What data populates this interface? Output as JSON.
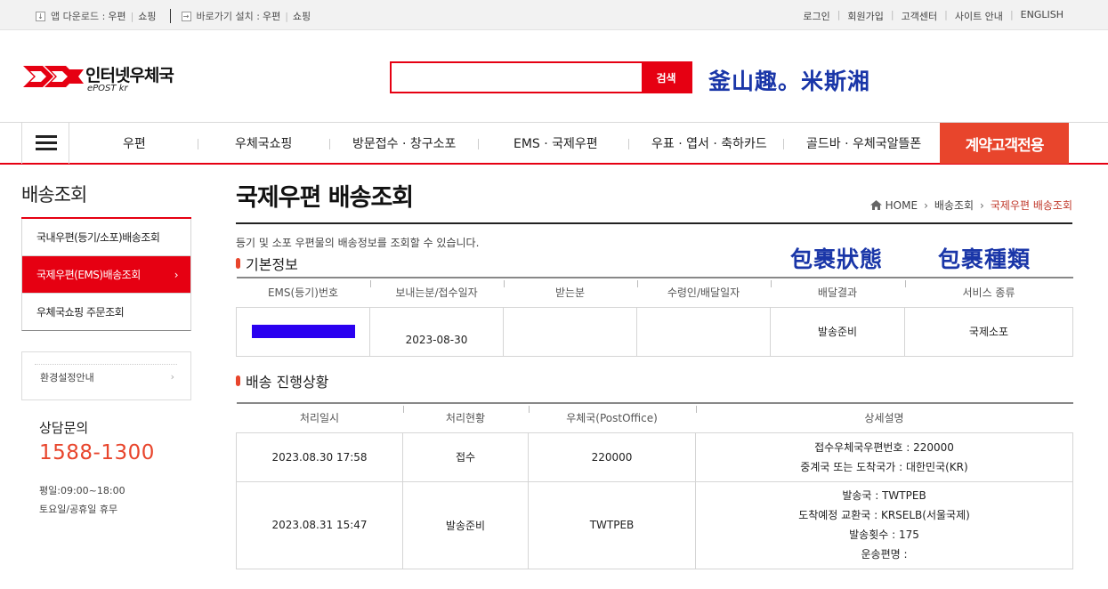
{
  "util_bar": {
    "app_download_label": "앱 다운로드 :",
    "app_links": [
      "우편",
      "쇼핑"
    ],
    "shortcut_label": "바로가기 설치 :",
    "shortcut_links": [
      "우편",
      "쇼핑"
    ],
    "right_links": [
      "로그인",
      "회원가입",
      "고객센터",
      "사이트 안내",
      "ENGLISH"
    ]
  },
  "header": {
    "logo_text": "인터넷우체국",
    "logo_sub": "ePOST kr",
    "search_placeholder": "",
    "search_button": "검색",
    "overlay_text": "釜山趣。米斯湘"
  },
  "nav": {
    "items": [
      "우편",
      "우체국쇼핑",
      "방문접수 · 창구소포",
      "EMS · 국제우편",
      "우표 · 엽서 · 축하카드",
      "골드바 · 우체국알뜰폰"
    ],
    "contract": "계약고객전용"
  },
  "sidebar": {
    "title": "배송조회",
    "items": [
      "국내우편(등기/소포)배송조회",
      "국제우편(EMS)배송조회",
      "우체국쇼핑 주문조회"
    ],
    "active_arrow": "›",
    "env_label": "환경설정안내",
    "env_arrow": "›",
    "contact_label": "상담문의",
    "contact_phone": "1588-1300",
    "hours_weekday": "평일:09:00~18:00",
    "hours_weekend": "토요일/공휴일 휴무"
  },
  "content": {
    "page_title": "국제우편 배송조회",
    "breadcrumb": [
      "HOME",
      "배송조회",
      "국제우편 배송조회"
    ],
    "description": "등기 및 소포 우편물의 배송정보를 조회할 수 있습니다.",
    "overlay_status": "包裹狀態",
    "overlay_type": "包裹種類",
    "basic": {
      "title": "기본정보",
      "headers": [
        "EMS(등기)번호",
        "보내는분/접수일자",
        "받는분",
        "수령인/배달일자",
        "배달결과",
        "서비스 종류"
      ],
      "row": {
        "sender_date": "2023-08-30",
        "receiver": "",
        "recipient_date": "",
        "result": "발송준비",
        "service": "국제소포"
      }
    },
    "progress": {
      "title": "배송 진행상황",
      "headers": [
        "처리일시",
        "처리현황",
        "우체국(PostOffice)",
        "상세설명"
      ],
      "rows": [
        {
          "datetime": "2023.08.30 17:58",
          "status": "접수",
          "office": "220000",
          "details": [
            "접수우체국우편번호 : 220000",
            "중계국 또는 도착국가 : 대한민국(KR)"
          ]
        },
        {
          "datetime": "2023.08.31 15:47",
          "status": "발송준비",
          "office": "TWTPEB",
          "details": [
            "발송국 : TWTPEB",
            "도착예정 교환국 : KRSELB(서울국제)",
            "발송횟수 : 175",
            "운송편명 :"
          ]
        }
      ]
    }
  }
}
